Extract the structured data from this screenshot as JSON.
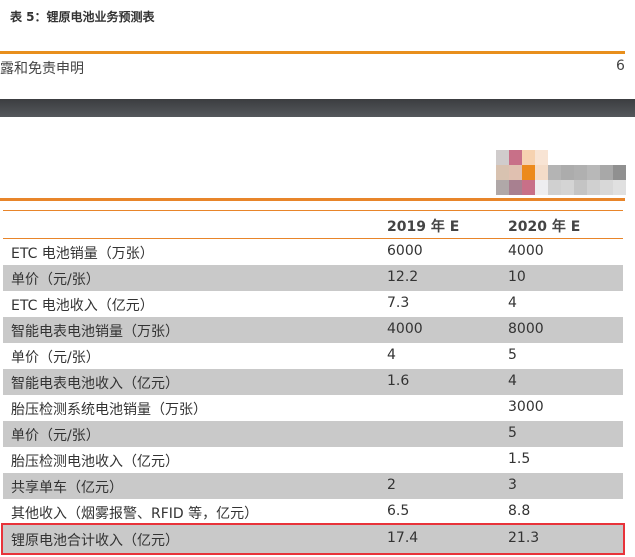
{
  "caption": "表 5：锂原电池业务预测表",
  "footer": {
    "left_text": "露和免责申明",
    "page_number": "6"
  },
  "table": {
    "headers": [
      "",
      "2019 年 E",
      "2020 年 E"
    ],
    "rows": [
      [
        "ETC 电池销量（万张）",
        "6000",
        "4000"
      ],
      [
        "单价（元/张）",
        "12.2",
        "10"
      ],
      [
        "ETC 电池收入（亿元）",
        "7.3",
        "4"
      ],
      [
        "智能电表电池销量（万张）",
        "4000",
        "8000"
      ],
      [
        "单价（元/张）",
        "4",
        "5"
      ],
      [
        "智能电表电池收入（亿元）",
        "1.6",
        "4"
      ],
      [
        "胎压检测系统电池销量（万张）",
        "",
        "3000"
      ],
      [
        "单价（元/张）",
        "",
        "5"
      ],
      [
        "胎压检测电池收入（亿元）",
        "",
        "1.5"
      ],
      [
        "共享单车（亿元）",
        "2",
        "3"
      ],
      [
        "其他收入（烟雾报警、RFID 等，亿元）",
        "6.5",
        "8.8"
      ],
      [
        "锂原电池合计收入（亿元）",
        "17.4",
        "21.3"
      ]
    ]
  },
  "colors": {
    "accent": "#e8852a",
    "row_gray": "#c9c9c9",
    "highlight": "#e8333a"
  }
}
